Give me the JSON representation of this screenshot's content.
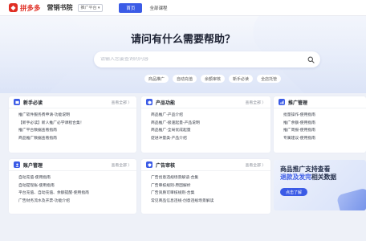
{
  "topbar": {
    "logo_text": "拼多多",
    "sub_title": "营销书院",
    "platform": "推广平台 ▾",
    "nav": [
      {
        "label": "首页",
        "active": true
      },
      {
        "label": "全部课程",
        "active": false
      }
    ]
  },
  "hero": {
    "title": "请问有什么需要帮助？",
    "search_placeholder": "请输入您要查询的内容",
    "tags": [
      "商品推广",
      "自动充值",
      "余额审核",
      "新手必读",
      "全店托管"
    ]
  },
  "cards": [
    {
      "title": "新手必读",
      "more": "查看全部 〉",
      "items": [
        "推广软件服务费申请-功能说明",
        "【新手必读】新人推广必学课程合集！",
        "推广平台数据查看指南",
        "商品推广数据查看指南"
      ]
    },
    {
      "title": "产品功能",
      "more": "查看全部 〉",
      "items": [
        "商品推广-产品介绍",
        "商品推广-极速起量-产品说明",
        "商品推广-全局优成起量",
        "促进冲量类-产品介绍"
      ]
    },
    {
      "title": "推广管理",
      "more": "",
      "items": [
        "批量操作-使用指南",
        "推广余额-使用指南",
        "推广周报-使用指南",
        "专属建议-使用指南"
      ]
    },
    {
      "title": "账户管理",
      "more": "查看全部 〉",
      "items": [
        "自动充值-使用指南",
        "自动提现账-使用指南",
        "平台充值、自动充值、余额提醒-使用指南",
        "广告财务流水及开票-功能介绍"
      ]
    },
    {
      "title": "广告审核",
      "more": "查看全部 〉",
      "items": [
        "广告创意违规场景解读-合集",
        "广告审核规则-原因解析",
        "广告资质可审核规则-合集",
        "常见商品信息违规-创意违规场景解读"
      ]
    }
  ],
  "banner": {
    "line1": "商品推广支持查看",
    "line2_highlight": "退款及发完",
    "line2_rest": "相关数据",
    "button": "点击了解"
  },
  "colors": {
    "brand": "#e02e24",
    "accent": "#3b5be6"
  }
}
